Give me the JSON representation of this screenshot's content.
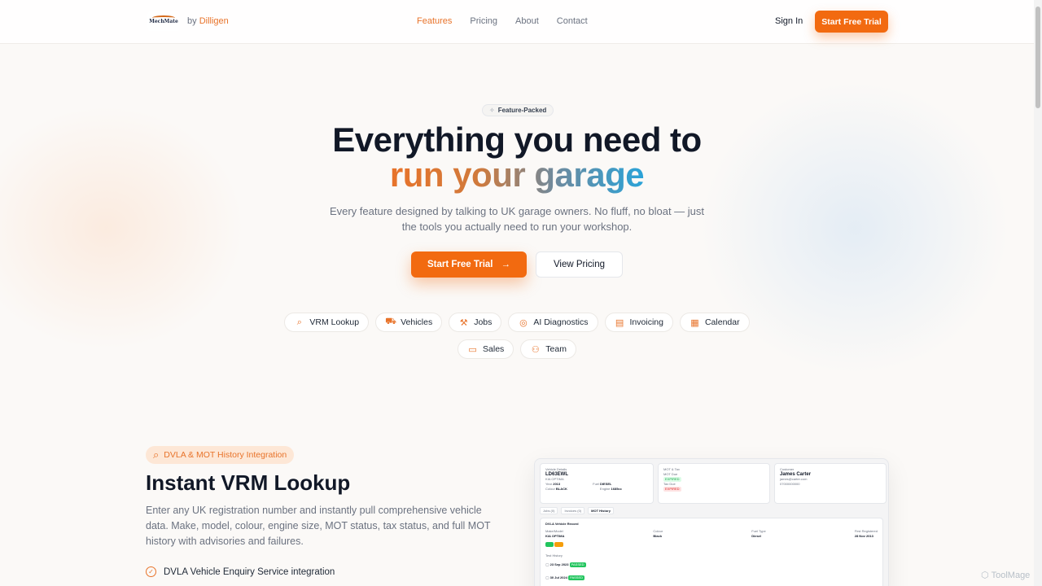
{
  "nav": {
    "logo_text": "MechMate",
    "by_prefix": "by",
    "brand": "Dilligen",
    "links": [
      {
        "label": "Features",
        "active": true
      },
      {
        "label": "Pricing",
        "active": false
      },
      {
        "label": "About",
        "active": false
      },
      {
        "label": "Contact",
        "active": false
      }
    ],
    "sign_in": "Sign In",
    "cta": "Start Free Trial"
  },
  "hero": {
    "badge": "Feature-Packed",
    "title_line1": "Everything you need to",
    "title_line2": "run your garage",
    "subtitle": "Every feature designed by talking to UK garage owners. No fluff, no bloat — just the tools you actually need to run your workshop.",
    "primary_button": "Start Free Trial",
    "secondary_button": "View Pricing",
    "chips_row1": [
      {
        "label": "VRM Lookup",
        "icon": "search-icon",
        "glyph": "⌕"
      },
      {
        "label": "Vehicles",
        "icon": "car-icon",
        "glyph": "⛟"
      },
      {
        "label": "Jobs",
        "icon": "wrench-icon",
        "glyph": "🔧"
      },
      {
        "label": "AI Diagnostics",
        "icon": "brain-icon",
        "glyph": "◎"
      },
      {
        "label": "Invoicing",
        "icon": "document-icon",
        "glyph": "▤"
      },
      {
        "label": "Calendar",
        "icon": "calendar-icon",
        "glyph": "▦"
      }
    ],
    "chips_row2": [
      {
        "label": "Sales",
        "icon": "banknote-icon",
        "glyph": "▭"
      },
      {
        "label": "Team",
        "icon": "users-icon",
        "glyph": "⚇"
      }
    ]
  },
  "section": {
    "pill": "DVLA & MOT History Integration",
    "title": "Instant VRM Lookup",
    "description": "Enter any UK registration number and instantly pull comprehensive vehicle data. Make, model, colour, engine size, MOT status, tax status, and full MOT history with advisories and failures.",
    "checklist": [
      "DVLA Vehicle Enquiry Service integration"
    ]
  },
  "preview": {
    "vehicle_card": {
      "heading": "Vehicle Details",
      "reg": "LD63EWL",
      "model": "KIA OPTIMA",
      "year_label": "Year",
      "year": "2013",
      "fuel_label": "Fuel",
      "fuel": "DIESEL",
      "colour_label": "Colour",
      "colour": "BLACK",
      "engine_label": "Engine",
      "engine": "1685cc"
    },
    "mot_card": {
      "heading": "MOT & Tax",
      "mot_label": "MOT Due",
      "mot_status": "EXPIRED",
      "tax_label": "Tax Due",
      "tax_status": "EXPIRED"
    },
    "customer_card": {
      "heading": "Customer",
      "name": "James Carter",
      "email": "james@carter.com",
      "phone": "07000000000"
    },
    "tabs": [
      "Jobs (0)",
      "Invoices (0)",
      "MOT History"
    ],
    "record": {
      "heading": "DVLA Vehicle Record",
      "cols": [
        {
          "label": "Make/Model",
          "value": "KIA OPTIMA"
        },
        {
          "label": "Colour",
          "value": "Black"
        },
        {
          "label": "Fuel Type",
          "value": "Diesel"
        },
        {
          "label": "First Registered",
          "value": "28 Nov 2013"
        }
      ],
      "history_label": "Test History",
      "tests": [
        {
          "date": "23 Sep 2023",
          "result": "PASSED"
        },
        {
          "date": "30 Jul 2024",
          "result": "PASSED"
        }
      ]
    }
  },
  "watermark": "ToolMage"
}
